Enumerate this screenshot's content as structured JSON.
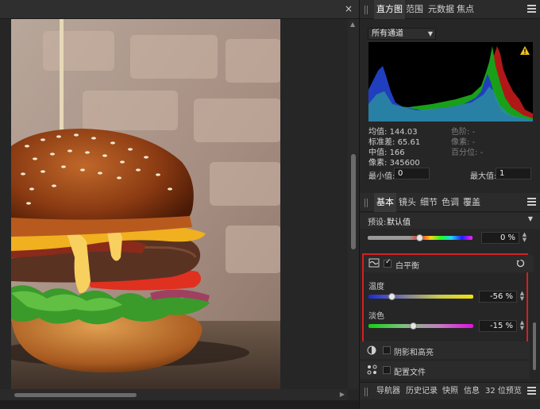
{
  "canvas": {
    "close_glyph": "×"
  },
  "histogram_panel": {
    "tabs": [
      "直方图",
      "范围",
      "元数据",
      "焦点"
    ],
    "channel": "所有通道",
    "stats_left": [
      {
        "label": "均值:",
        "value": "144.03"
      },
      {
        "label": "标准差:",
        "value": "65.61"
      },
      {
        "label": "中值:",
        "value": "166"
      },
      {
        "label": "像素:",
        "value": "345600"
      }
    ],
    "stats_right": [
      {
        "label": "色阶:",
        "value": "-"
      },
      {
        "label": "像素:",
        "value": "-"
      },
      {
        "label": "百分位:",
        "value": "-"
      }
    ],
    "min_label": "最小值:",
    "min_value": "0",
    "max_label": "最大值:",
    "max_value": "1"
  },
  "adjust_panel": {
    "tabs": [
      "基本",
      "镜头",
      "细节",
      "色调",
      "覆盖"
    ],
    "preset_label": "预设:",
    "preset_value": "默认值",
    "top_slider_value": "0 %",
    "white_balance": {
      "title": "白平衡",
      "enabled": true,
      "temperature_label": "温度",
      "temperature_value": "-56 %",
      "temperature_level": -0.56,
      "tint_label": "淡色",
      "tint_value": "-15 %",
      "tint_level": -0.15
    },
    "shadows_highlights": {
      "title": "阴影和高亮",
      "enabled": false
    },
    "profile": {
      "title": "配置文件",
      "enabled": false
    }
  },
  "bottom_tabs": [
    "导航器",
    "历史记录",
    "快照",
    "信息",
    "32 位预览"
  ],
  "colors": {
    "accent_red": "#d42020",
    "panel_bg": "#262626"
  }
}
